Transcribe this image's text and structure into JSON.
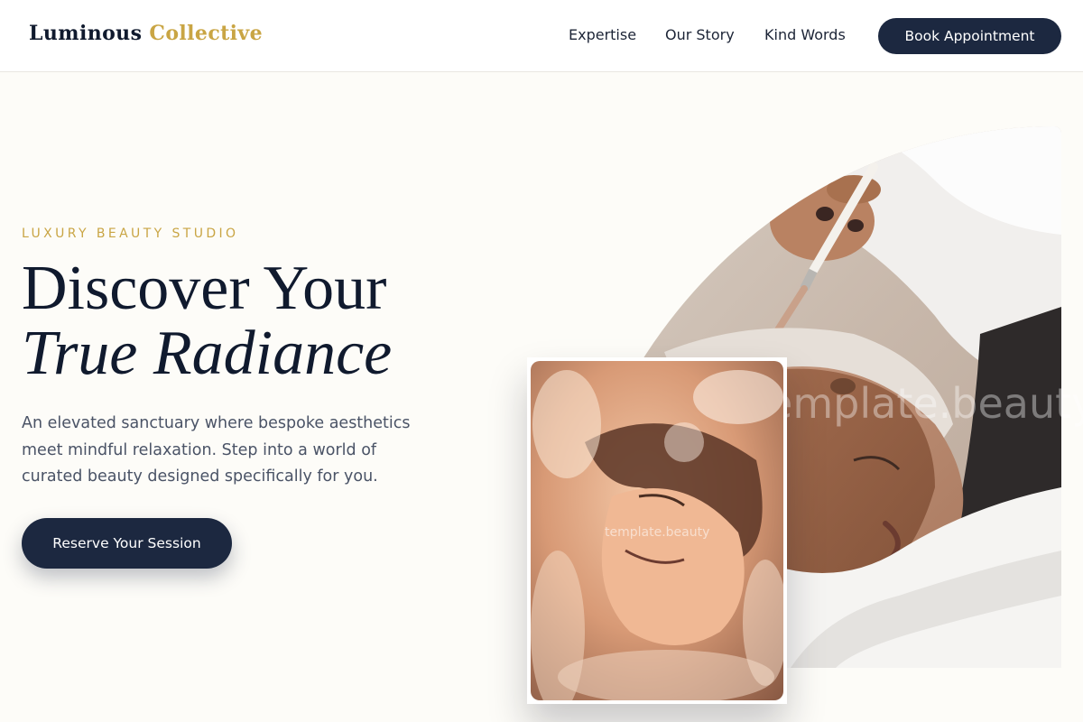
{
  "header": {
    "logo_primary": "Luminous",
    "logo_accent": "Collective",
    "nav": [
      {
        "label": "Expertise"
      },
      {
        "label": "Our Story"
      },
      {
        "label": "Kind Words"
      }
    ],
    "cta_label": "Book Appointment"
  },
  "hero": {
    "eyebrow": "LUXURY BEAUTY STUDIO",
    "headline_line1": "Discover Your",
    "headline_line2": "True Radiance",
    "description": "An elevated sanctuary where bespoke aesthetics meet mindful relaxation. Step into a world of curated beauty designed specifically for you.",
    "cta_label": "Reserve Your Session"
  },
  "images": {
    "main_watermark": "template.beauty",
    "inset_watermark": "template.beauty"
  },
  "colors": {
    "brand_navy": "#1c2840",
    "accent_gold": "#c9a544",
    "background": "#fdfcf8"
  }
}
